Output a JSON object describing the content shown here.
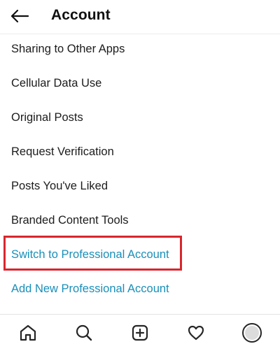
{
  "header": {
    "title": "Account",
    "back_icon": "arrow-left-icon"
  },
  "menu": {
    "items": [
      {
        "label": "Sharing to Other Apps"
      },
      {
        "label": "Cellular Data Use"
      },
      {
        "label": "Original Posts"
      },
      {
        "label": "Request Verification"
      },
      {
        "label": "Posts You've Liked"
      },
      {
        "label": "Branded Content Tools"
      },
      {
        "label": "Switch to Professional Account",
        "highlighted": true
      },
      {
        "label": "Add New Professional Account"
      }
    ]
  },
  "bottom_nav": {
    "items": [
      {
        "icon": "home-icon"
      },
      {
        "icon": "search-icon"
      },
      {
        "icon": "new-post-icon"
      },
      {
        "icon": "heart-icon"
      },
      {
        "icon": "profile-avatar"
      }
    ]
  },
  "colors": {
    "link_blue": "#1a8fb9",
    "highlight_red": "#d9262e",
    "text": "#1c1c1c"
  }
}
